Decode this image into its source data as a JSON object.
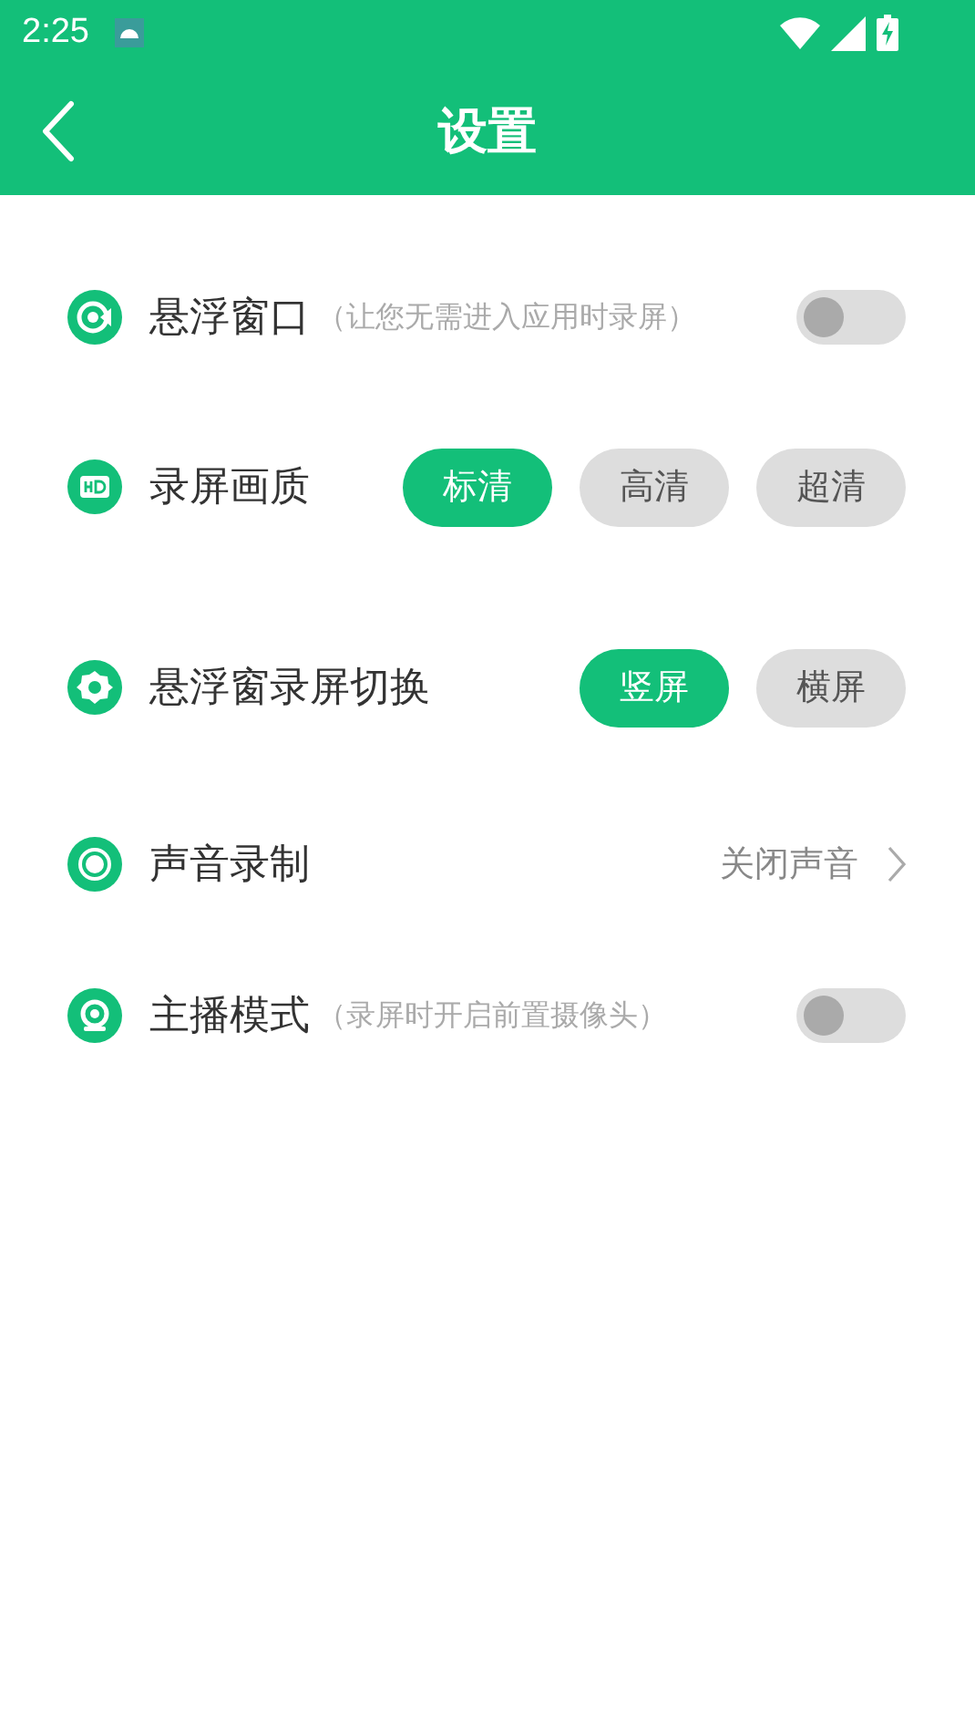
{
  "status_bar": {
    "time": "2:25"
  },
  "toolbar": {
    "title": "设置"
  },
  "settings": [
    {
      "kind": "toggle",
      "label": "悬浮窗口",
      "hint": "（让您无需进入应用时录屏）",
      "on": false
    },
    {
      "kind": "options",
      "label": "录屏画质",
      "options": [
        {
          "label": "标清",
          "selected": true
        },
        {
          "label": "高清",
          "selected": false
        },
        {
          "label": "超清",
          "selected": false
        }
      ]
    },
    {
      "kind": "options",
      "label": "悬浮窗录屏切换",
      "options": [
        {
          "label": "竖屏",
          "selected": true
        },
        {
          "label": "横屏",
          "selected": false
        }
      ]
    },
    {
      "kind": "value",
      "label": "声音录制",
      "value": "关闭声音"
    },
    {
      "kind": "toggle",
      "label": "主播模式",
      "hint": "（录屏时开启前置摄像头）",
      "on": false
    }
  ]
}
